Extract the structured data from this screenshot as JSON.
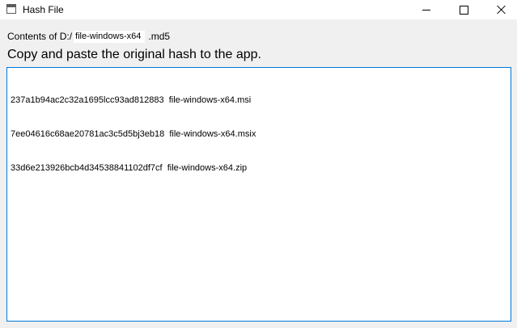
{
  "window": {
    "title": "Hash File",
    "controls": [
      "minimize",
      "maximize",
      "close"
    ]
  },
  "path": {
    "prefix": "Contents of D:/",
    "filename": "file-windows-x64",
    "extension": ".md5"
  },
  "instruction": "Copy and paste the original hash to the app.",
  "hash_lines": [
    "237a1b94ac2c32a1695lcc93ad812883  file-windows-x64.msi",
    "7ee04616c68ae20781ac3c5d5bj3eb18  file-windows-x64.msix",
    "33d6e213926bcb4d34538841102df7cf  file-windows-x64.zip"
  ],
  "icons": {
    "app": "window-app-icon",
    "minimize": "minimize-icon",
    "maximize": "maximize-icon",
    "close": "close-icon"
  }
}
